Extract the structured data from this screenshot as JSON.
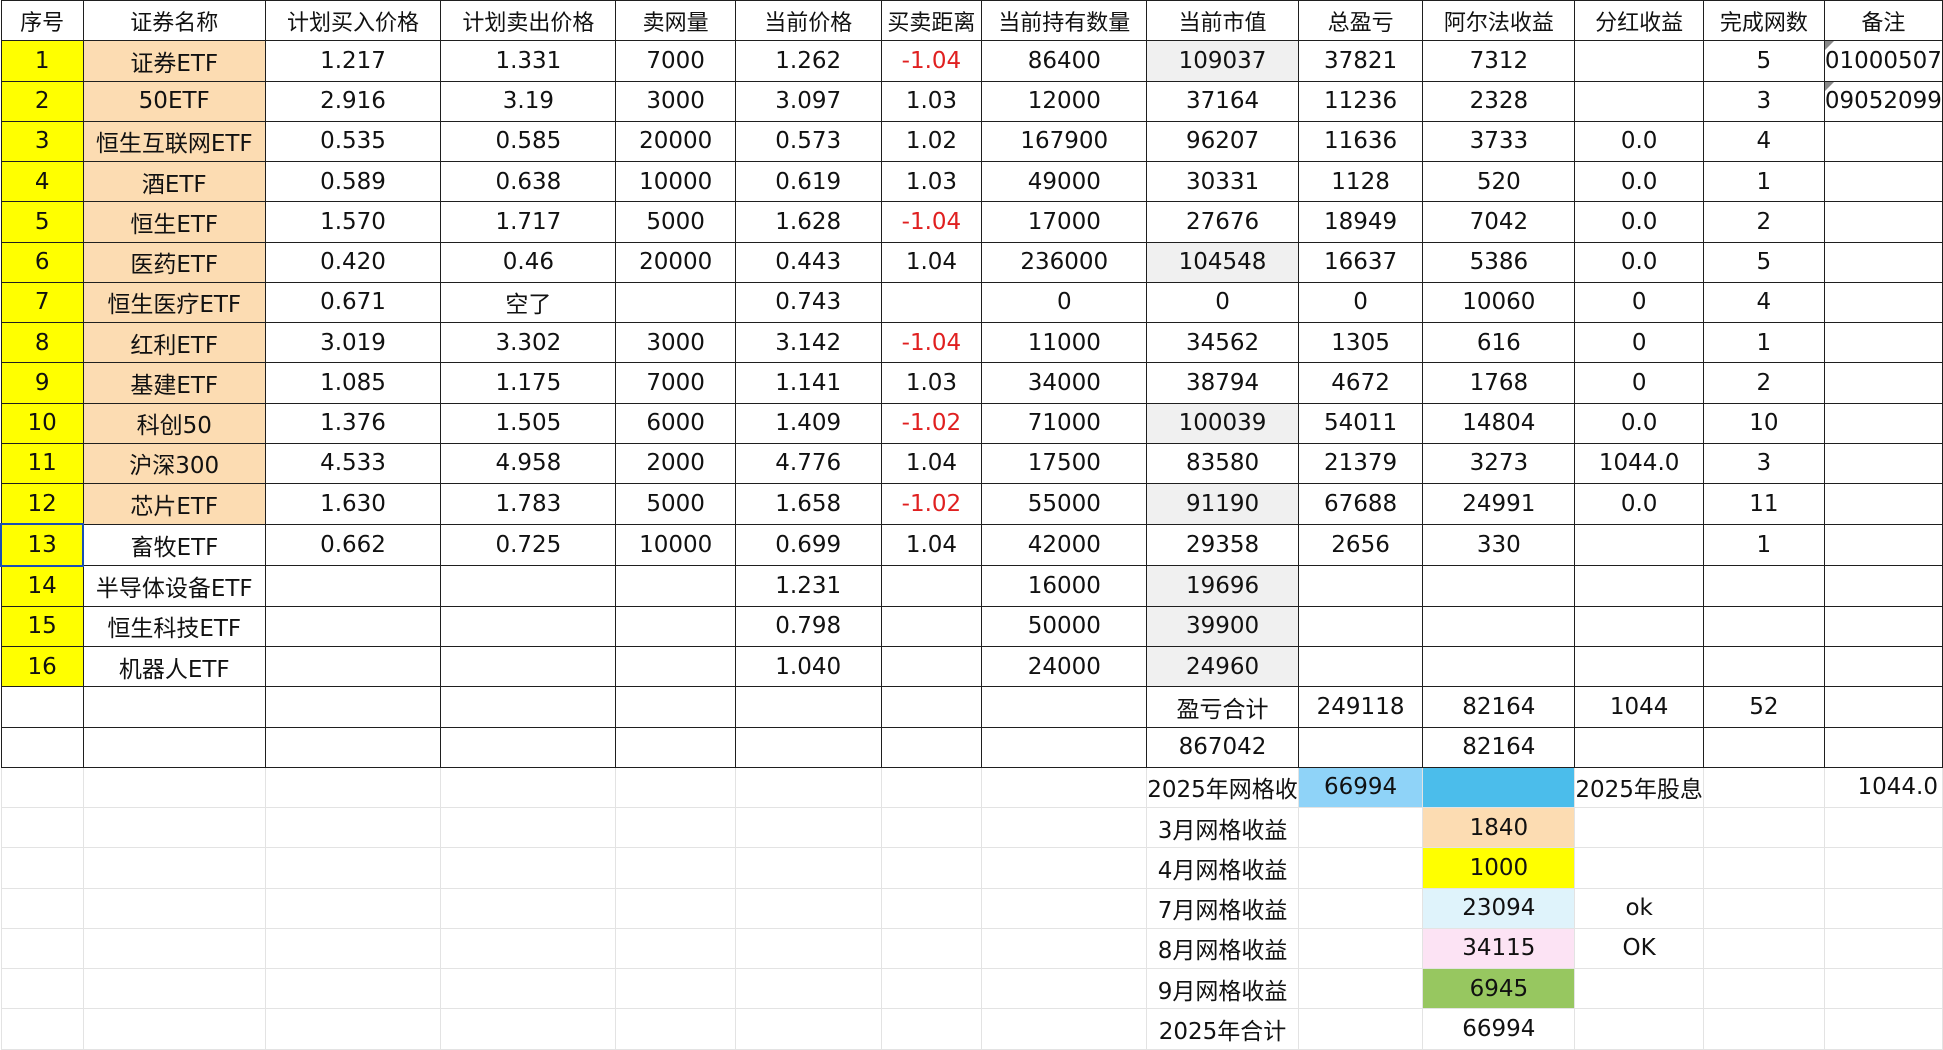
{
  "headers": [
    "序号",
    "证券名称",
    "计划买入价格",
    "计划卖出价格",
    "卖网量",
    "当前价格",
    "买卖距离",
    "当前持有数量",
    "当前市值",
    "总盈亏",
    "阿尔法收益",
    "分红收益",
    "完成网数",
    "备注"
  ],
  "rows": [
    {
      "seq": "1",
      "name": "证券ETF",
      "buy": "1.217",
      "sell": "1.331",
      "qty": "7000",
      "price": "1.262",
      "dist": "-1.04",
      "hold": "86400",
      "value": "109037",
      "pnl": "37821",
      "alpha": "7312",
      "div": "",
      "grids": "5",
      "note": "01000507"
    },
    {
      "seq": "2",
      "name": "50ETF",
      "buy": "2.916",
      "sell": "3.19",
      "qty": "3000",
      "price": "3.097",
      "dist": "1.03",
      "hold": "12000",
      "value": "37164",
      "pnl": "11236",
      "alpha": "2328",
      "div": "",
      "grids": "3",
      "note": "09052099"
    },
    {
      "seq": "3",
      "name": "恒生互联网ETF",
      "buy": "0.535",
      "sell": "0.585",
      "qty": "20000",
      "price": "0.573",
      "dist": "1.02",
      "hold": "167900",
      "value": "96207",
      "pnl": "11636",
      "alpha": "3733",
      "div": "0.0",
      "grids": "4",
      "note": ""
    },
    {
      "seq": "4",
      "name": "酒ETF",
      "buy": "0.589",
      "sell": "0.638",
      "qty": "10000",
      "price": "0.619",
      "dist": "1.03",
      "hold": "49000",
      "value": "30331",
      "pnl": "1128",
      "alpha": "520",
      "div": "0.0",
      "grids": "1",
      "note": ""
    },
    {
      "seq": "5",
      "name": "恒生ETF",
      "buy": "1.570",
      "sell": "1.717",
      "qty": "5000",
      "price": "1.628",
      "dist": "-1.04",
      "hold": "17000",
      "value": "27676",
      "pnl": "18949",
      "alpha": "7042",
      "div": "0.0",
      "grids": "2",
      "note": ""
    },
    {
      "seq": "6",
      "name": "医药ETF",
      "buy": "0.420",
      "sell": "0.46",
      "qty": "20000",
      "price": "0.443",
      "dist": "1.04",
      "hold": "236000",
      "value": "104548",
      "pnl": "16637",
      "alpha": "5386",
      "div": "0.0",
      "grids": "5",
      "note": ""
    },
    {
      "seq": "7",
      "name": "恒生医疗ETF",
      "buy": "0.671",
      "sell": "空了",
      "qty": "",
      "price": "0.743",
      "dist": "",
      "hold": "0",
      "value": "0",
      "pnl": "0",
      "alpha": "10060",
      "div": "0",
      "grids": "4",
      "note": ""
    },
    {
      "seq": "8",
      "name": "红利ETF",
      "buy": "3.019",
      "sell": "3.302",
      "qty": "3000",
      "price": "3.142",
      "dist": "-1.04",
      "hold": "11000",
      "value": "34562",
      "pnl": "1305",
      "alpha": "616",
      "div": "0",
      "grids": "1",
      "note": ""
    },
    {
      "seq": "9",
      "name": "基建ETF",
      "buy": "1.085",
      "sell": "1.175",
      "qty": "7000",
      "price": "1.141",
      "dist": "1.03",
      "hold": "34000",
      "value": "38794",
      "pnl": "4672",
      "alpha": "1768",
      "div": "0",
      "grids": "2",
      "note": ""
    },
    {
      "seq": "10",
      "name": "科创50",
      "buy": "1.376",
      "sell": "1.505",
      "qty": "6000",
      "price": "1.409",
      "dist": "-1.02",
      "hold": "71000",
      "value": "100039",
      "pnl": "54011",
      "alpha": "14804",
      "div": "0.0",
      "grids": "10",
      "note": ""
    },
    {
      "seq": "11",
      "name": "沪深300",
      "buy": "4.533",
      "sell": "4.958",
      "qty": "2000",
      "price": "4.776",
      "dist": "1.04",
      "hold": "17500",
      "value": "83580",
      "pnl": "21379",
      "alpha": "3273",
      "div": "1044.0",
      "grids": "3",
      "note": ""
    },
    {
      "seq": "12",
      "name": "芯片ETF",
      "buy": "1.630",
      "sell": "1.783",
      "qty": "5000",
      "price": "1.658",
      "dist": "-1.02",
      "hold": "55000",
      "value": "91190",
      "pnl": "67688",
      "alpha": "24991",
      "div": "0.0",
      "grids": "11",
      "note": ""
    },
    {
      "seq": "13",
      "name": "畜牧ETF",
      "buy": "0.662",
      "sell": "0.725",
      "qty": "10000",
      "price": "0.699",
      "dist": "1.04",
      "hold": "42000",
      "value": "29358",
      "pnl": "2656",
      "alpha": "330",
      "div": "",
      "grids": "1",
      "note": ""
    },
    {
      "seq": "14",
      "name": "半导体设备ETF",
      "buy": "",
      "sell": "",
      "qty": "",
      "price": "1.231",
      "dist": "",
      "hold": "16000",
      "value": "19696",
      "pnl": "",
      "alpha": "",
      "div": "",
      "grids": "",
      "note": ""
    },
    {
      "seq": "15",
      "name": "恒生科技ETF",
      "buy": "",
      "sell": "",
      "qty": "",
      "price": "0.798",
      "dist": "",
      "hold": "50000",
      "value": "39900",
      "pnl": "",
      "alpha": "",
      "div": "",
      "grids": "",
      "note": ""
    },
    {
      "seq": "16",
      "name": "机器人ETF",
      "buy": "",
      "sell": "",
      "qty": "",
      "price": "1.040",
      "dist": "",
      "hold": "24000",
      "value": "24960",
      "pnl": "",
      "alpha": "",
      "div": "",
      "grids": "",
      "note": ""
    }
  ],
  "totals": {
    "label": "盈亏合计",
    "pnl": "249118",
    "alpha": "82164",
    "div": "1044",
    "grids": "52"
  },
  "totals2": {
    "value": "867042",
    "alpha": "82164"
  },
  "summary": {
    "grid_label": "2025年网格收",
    "grid_value": "66994",
    "dividend_label": "2025年股息",
    "dividend_value": "1044.0",
    "months": [
      {
        "label": "3月网格收益",
        "value": "1840",
        "mark": ""
      },
      {
        "label": "4月网格收益",
        "value": "1000",
        "mark": ""
      },
      {
        "label": "7月网格收益",
        "value": "23094",
        "mark": "ok"
      },
      {
        "label": "8月网格收益",
        "value": "34115",
        "mark": "OK"
      },
      {
        "label": "9月网格收益",
        "value": "6945",
        "mark": ""
      }
    ],
    "total_label": "2025年合计",
    "total_value": "66994"
  },
  "colors": {
    "seq": "#ffff00",
    "name": "#fcdcb2",
    "negative": "#e02020",
    "month_colors": [
      "#fcdcb2",
      "#ffff00",
      "#dff3fb",
      "#fce3f4",
      "#97c760"
    ]
  }
}
